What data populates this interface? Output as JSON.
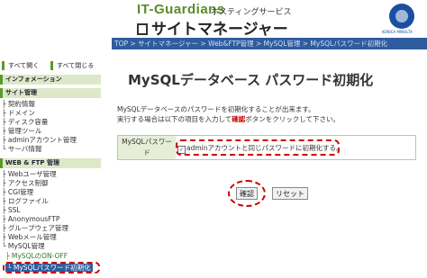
{
  "header": {
    "brand": "IT-Guardians",
    "service": "ホスティングサービス",
    "title": "サイトマネージャー",
    "konica_text": "KONICA MINOLTA"
  },
  "breadcrumb": "TOP > サイトマネージャー > Web&FTP管理 > MySQL管理 > MySQLパスワード初期化",
  "sidebar": {
    "expand_all": "すべて開く",
    "collapse_all": "すべて閉じる",
    "sections": {
      "info": "インフォメーション",
      "site": "サイト管理",
      "webftp": "WEB & FTP 管理"
    },
    "site_items": [
      "├ 契約情報",
      "├ ドメイン",
      "├ ディスク容量",
      "├ 管理ツール",
      "├ adminアカウント管理",
      "└ サーバ情報"
    ],
    "webftp_items": [
      "├ Webユーザ管理",
      "├ アクセス制御",
      "├ CGI管理",
      "├ ログファイル",
      "├ SSL",
      "├ AnonymousFTP",
      "├ グループウェア管理",
      "├ Webメール管理",
      "└ MySQL管理"
    ],
    "mysql_sub": [
      "├ MySQLのON-OFF",
      "└ MySQLパスワード初期化"
    ]
  },
  "main": {
    "title": "MySQLデータベース パスワード初期化",
    "desc_line1": "MySQLデータベースのパスワードを初期化することが出来ます。",
    "desc_line2_pre": "実行する場合は以下の項目を入力して",
    "desc_line2_bold": "確認",
    "desc_line2_post": "ボタンをクリックして下さい。",
    "form_label_1": "MySQLパスワー",
    "form_label_2": "ド",
    "checkbox_label": "adminアカウントと同じパスワードに初期化する。",
    "checkbox_checked": true,
    "confirm_button": "確認",
    "reset_button": "リセット"
  },
  "colors": {
    "accent": "#2e5c9e",
    "brand_green": "#5a8a2a",
    "highlight": "#cc0000"
  }
}
